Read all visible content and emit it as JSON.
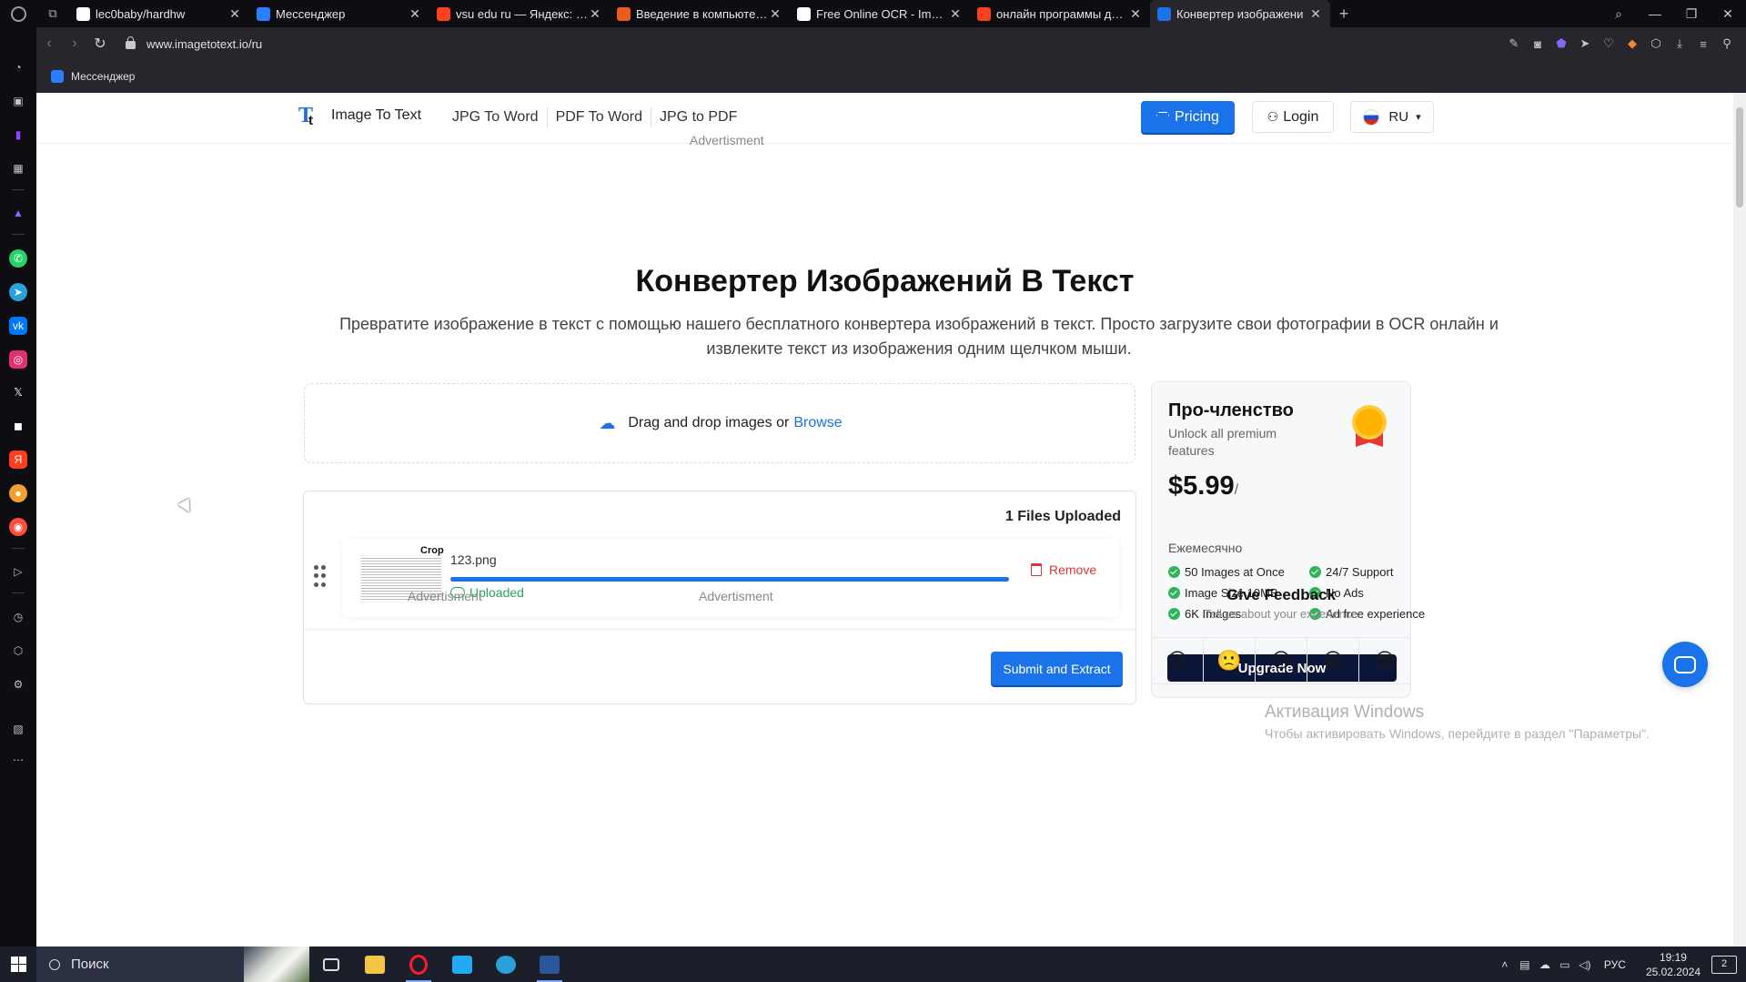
{
  "browser": {
    "tabs": [
      {
        "title": "lec0baby/hardhw",
        "favicon": "github-icon",
        "color": "#ffffff",
        "active": false
      },
      {
        "title": "Мессенджер",
        "favicon": "messenger-icon",
        "color": "#2b7fff",
        "active": false
      },
      {
        "title": "vsu edu ru — Яндекс: наш",
        "favicon": "yandex-icon",
        "color": "#fc3f1d",
        "active": false
      },
      {
        "title": "Введение в компьютерну",
        "favicon": "mooc-icon",
        "color": "#e85d1e",
        "active": false
      },
      {
        "title": "Free Online OCR - Image t",
        "favicon": "ocr-icon",
        "color": "#ffffff",
        "active": false
      },
      {
        "title": "онлайн программы для р",
        "favicon": "yandex-icon",
        "color": "#fc3f1d",
        "active": false
      },
      {
        "title": "Конвертер изображени",
        "favicon": "imagetotext-icon",
        "color": "#1a73e8",
        "active": true
      }
    ],
    "url": "www.imagetotext.io/ru",
    "bookmark": "Мессенджер"
  },
  "site": {
    "logo_text": "Image To Text",
    "nav": [
      "JPG To Word",
      "PDF To Word",
      "JPG to PDF"
    ],
    "pricing_label": "Pricing",
    "login_label": "Login",
    "lang_label": "RU"
  },
  "main": {
    "ad_top": "Advertisment",
    "title": "Конвертер Изображений В Текст",
    "subtitle": "Превратите изображение в текст с помощью нашего бесплатного конвертера изображений в текст. Просто загрузите свои фотографии в OCR онлайн и извлеките текст из изображения одним щелчком мыши.",
    "dropzone_text": "Drag and drop images or",
    "dropzone_link": "Browse",
    "files_count": "1 Files Uploaded",
    "file": {
      "crop_label": "Crop",
      "name": "123.png",
      "progress": 1.0,
      "status": "Uploaded",
      "remove_label": "Remove"
    },
    "submit_label": "Submit and Extract",
    "ad_bottom_left": "Advertisment",
    "ad_bottom_right": "Advertisment"
  },
  "pro": {
    "title": "Про-членство",
    "subtitle": "Unlock all premium features",
    "price": "$5.99",
    "price_suffix": "/",
    "period": "Ежемесячно",
    "features": [
      "50 Images at Once",
      "24/7 Support",
      "Image Size 10MB",
      "No Ads",
      "6K Images",
      "Ad free experience"
    ],
    "upgrade_label": "Upgrade Now"
  },
  "feedback": {
    "title": "Give Feedback",
    "subtitle": "Tell us about your experience",
    "faces": [
      "😖",
      "🙁",
      "😐",
      "😀",
      "😎"
    ]
  },
  "windows": {
    "activate_title": "Активация Windows",
    "activate_sub": "Чтобы активировать Windows, перейдите в раздел \"Параметры\".",
    "search_placeholder": "Поиск",
    "lang": "РУС",
    "time": "19:19",
    "date": "25.02.2024",
    "notifications": "2"
  },
  "colors": {
    "accent": "#1a73e8",
    "dark_button": "#0b1537",
    "success": "#26a65b",
    "danger": "#e0353b"
  }
}
